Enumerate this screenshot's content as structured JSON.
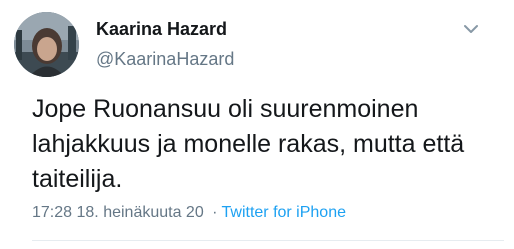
{
  "author": {
    "display_name": "Kaarina Hazard",
    "handle": "@KaarinaHazard",
    "avatar_icon": "profile-photo"
  },
  "tweet": {
    "text": "Jope Ruonansuu oli suurenmoinen lahjakkuus ja monelle rakas, mutta että taiteilija.",
    "time": "17:28",
    "date": "18. heinäkuuta 20",
    "separator": "·",
    "source": "Twitter for iPhone"
  },
  "icons": {
    "menu": "chevron-down-icon"
  },
  "colors": {
    "text_primary": "#14171a",
    "text_secondary": "#657786",
    "link": "#1da1f2"
  }
}
